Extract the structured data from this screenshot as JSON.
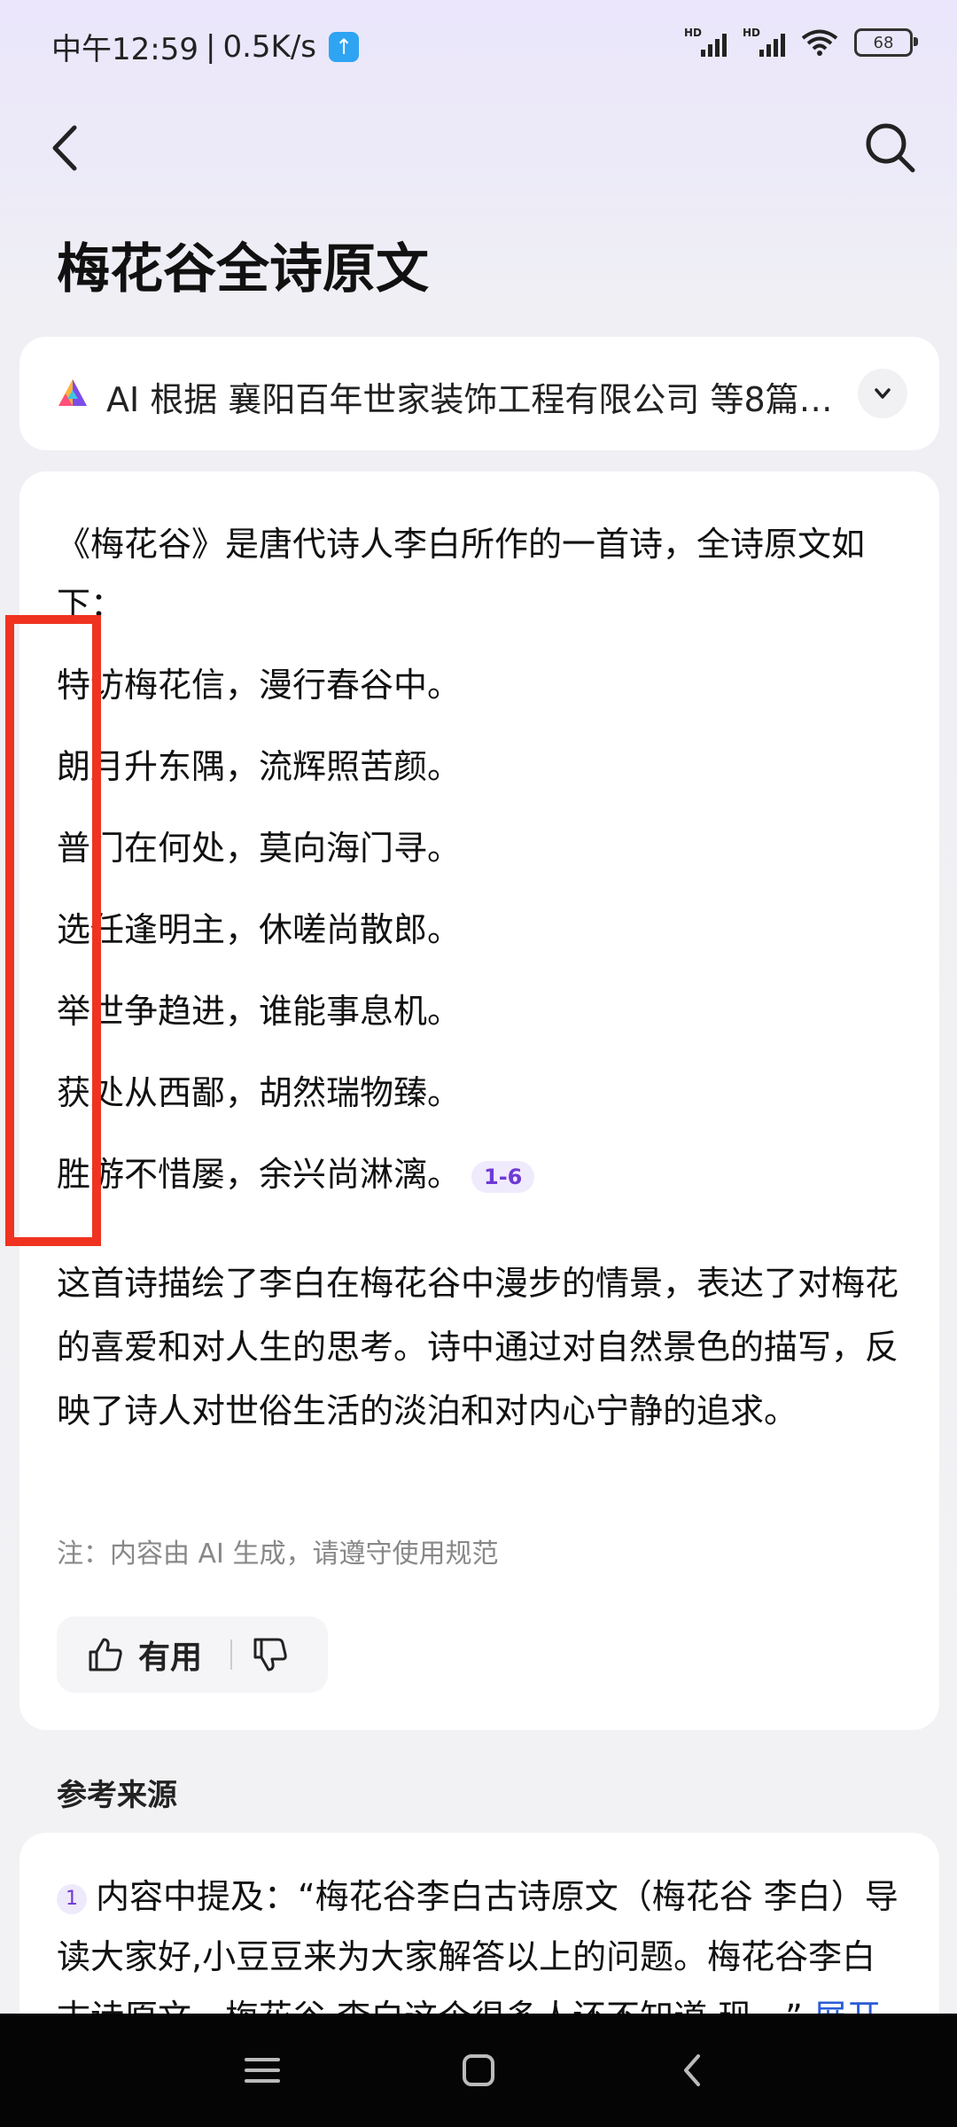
{
  "status_bar": {
    "time": "中午12:59",
    "net_speed": "0.5K/s",
    "upload_icon": "upload-arrow-icon",
    "hd_label": "HD",
    "battery": "68"
  },
  "header": {
    "back_icon": "chevron-left-icon",
    "search_icon": "search-icon",
    "title": "梅花谷全诗原文"
  },
  "ai_source": {
    "text": "AI 根据 襄阳百年世家装饰工程有限公司 等8篇…",
    "expand_icon": "chevron-down-icon"
  },
  "answer": {
    "intro": "《梅花谷》是唐代诗人李白所作的一首诗，全诗原文如下：",
    "poem_lines": [
      "特访梅花信，漫行春谷中。",
      "朗月升东隅，流辉照苦颜。",
      "普门在何处，莫向海门寻。",
      "选任逢明主，休嗟尚散郎。",
      "举世争趋进，谁能事息机。",
      "获处从西鄙，胡然瑞物臻。",
      "胜游不惜屡，余兴尚淋漓。"
    ],
    "citation": "1-6",
    "summary": "这首诗描绘了李白在梅花谷中漫步的情景，表达了对梅花的喜爱和对人生的思考。诗中通过对自然景色的描写，反映了诗人对世俗生活的淡泊和对内心宁静的追求。",
    "note": "注：内容由 AI 生成，请遵守使用规范",
    "useful_label": "有用"
  },
  "references": {
    "title": "参考来源",
    "items": [
      {
        "num": "1",
        "text": "内容中提及：“梅花谷李白古诗原文（梅花谷 李白）导读大家好,小豆豆来为大家解答以上的问题。梅花谷李白古诗原文，梅花谷 李白这个很多人还不知道,现…”",
        "expand": "展开"
      }
    ]
  },
  "colors": {
    "highlight": "#ef3320",
    "accent": "#6e3ad6",
    "link": "#2a5bd7"
  }
}
